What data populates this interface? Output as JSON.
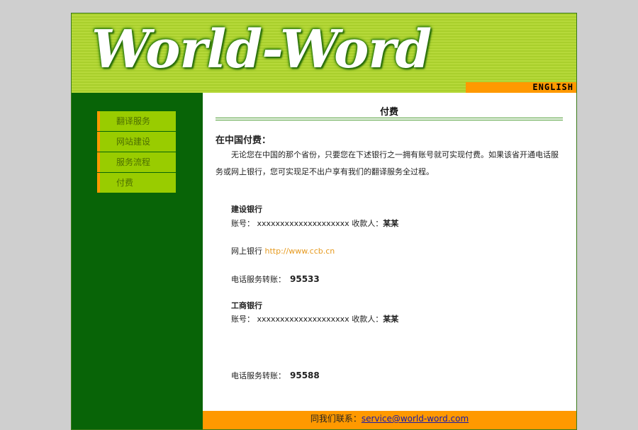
{
  "header": {
    "logo_text": "World-Word",
    "language_link": "ENGLISH"
  },
  "sidebar": {
    "items": [
      {
        "label": "翻译服务"
      },
      {
        "label": "网站建设"
      },
      {
        "label": "服务流程"
      },
      {
        "label": "付费"
      }
    ]
  },
  "content": {
    "page_title": "付费",
    "section_heading": "在中国付费：",
    "intro": "无论您在中国的那个省份，只要您在下述银行之一拥有账号就可实现付费。如果该省开通电话服务或网上银行，您可实现足不出户享有我们的翻译服务全过程。",
    "banks": [
      {
        "name": "建设银行",
        "account_label": "账号：",
        "account_number": "xxxxxxxxxxxxxxxxxxxx",
        "payee_label": "收款人：",
        "payee": "某某",
        "ebank_label": "网上银行",
        "ebank_url": "http://www.ccb.cn",
        "phone_label": "电话服务转账：",
        "phone_number": "95533"
      },
      {
        "name": "工商银行",
        "account_label": "账号：",
        "account_number": "xxxxxxxxxxxxxxxxxxxx",
        "payee_label": "收款人：",
        "payee": "某某",
        "phone_label": "电话服务转账：",
        "phone_number": "95588"
      }
    ]
  },
  "footer": {
    "contact_label": "同我们联系：",
    "email": "service@world-word.com"
  },
  "colors": {
    "header_green": "#b6d93a",
    "sidebar_green": "#086407",
    "nav_item": "#99cc00",
    "accent_orange": "#ff9900"
  }
}
